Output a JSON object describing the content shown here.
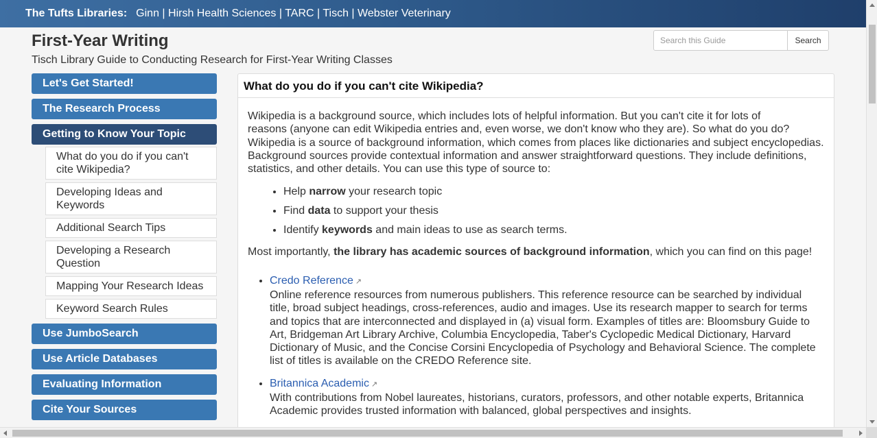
{
  "header": {
    "lead": "The Tufts Libraries:",
    "libraries": [
      "Ginn",
      "Hirsh Health Sciences",
      "TARC",
      "Tisch",
      "Webster Veterinary"
    ],
    "separator": " | "
  },
  "guide": {
    "title": "First-Year Writing",
    "subtitle": "Tisch Library Guide to Conducting Research for First-Year Writing Classes"
  },
  "search": {
    "placeholder": "Search this Guide",
    "button_label": "Search"
  },
  "nav": {
    "items": [
      {
        "label": "Let's Get Started!"
      },
      {
        "label": "The Research Process"
      },
      {
        "label": "Getting to Know Your Topic"
      },
      {
        "label": "Use JumboSearch"
      },
      {
        "label": "Use Article Databases"
      },
      {
        "label": "Evaluating Information"
      },
      {
        "label": "Cite Your Sources"
      }
    ],
    "subitems": [
      {
        "label": "What do you do if you can't cite Wikipedia?"
      },
      {
        "label": "Developing Ideas and Keywords"
      },
      {
        "label": "Additional Search Tips"
      },
      {
        "label": "Developing a Research Question"
      },
      {
        "label": "Mapping Your Research Ideas"
      },
      {
        "label": "Keyword Search Rules"
      }
    ]
  },
  "content": {
    "heading": "What do you do if you can't cite Wikipedia?",
    "intro_1": "Wikipedia is a background source, which includes lots of helpful information. But you can't cite it for lots of",
    "intro_2": "reasons (anyone can edit Wikipedia entries and, even worse, we don't know who they are). So what do you do? Wikipedia is a source of background information, which comes from places like dictionaries and subject encyclopedias. Background sources provide contextual information and answer straightforward questions. They include definitions, statistics, and other details. You can use this type of source to:",
    "bullets": [
      {
        "pre": "Help ",
        "bold": "narrow",
        "post": " your research topic"
      },
      {
        "pre": "Find ",
        "bold": "data",
        "post": " to support your thesis"
      },
      {
        "pre": "Identify ",
        "bold": "keywords",
        "post": " and main ideas to use as search terms."
      }
    ],
    "important_pre": "Most importantly, ",
    "important_bold": "the library has academic sources of background information",
    "important_post": ", which you can find on this page!",
    "resources": [
      {
        "name": "Credo Reference",
        "description": "Online reference resources from numerous publishers. This reference resource can be searched by individual title, broad subject headings, cross-references, audio and images. Use its research mapper to search for terms and topics that are interconnected and displayed in (a) visual form. Examples of titles are: Bloomsbury Guide to Art, Bridgeman Art Library Archive, Columbia Encyclopedia, Taber's Cyclopedic Medical Dictionary, Harvard Dictionary of Music, and the Concise Corsini Encyclopedia of Psychology and Behavioral Science. The complete list of titles is available on the CREDO Reference site."
      },
      {
        "name": "Britannica Academic",
        "description": "With contributions from Nobel laureates, historians, curators, professors, and other notable experts, Britannica Academic provides trusted information with balanced, global perspectives and insights."
      }
    ]
  },
  "colors": {
    "nav_button": "#3a78b3",
    "nav_button_active": "#2d4d77",
    "link": "#2a5db0"
  }
}
